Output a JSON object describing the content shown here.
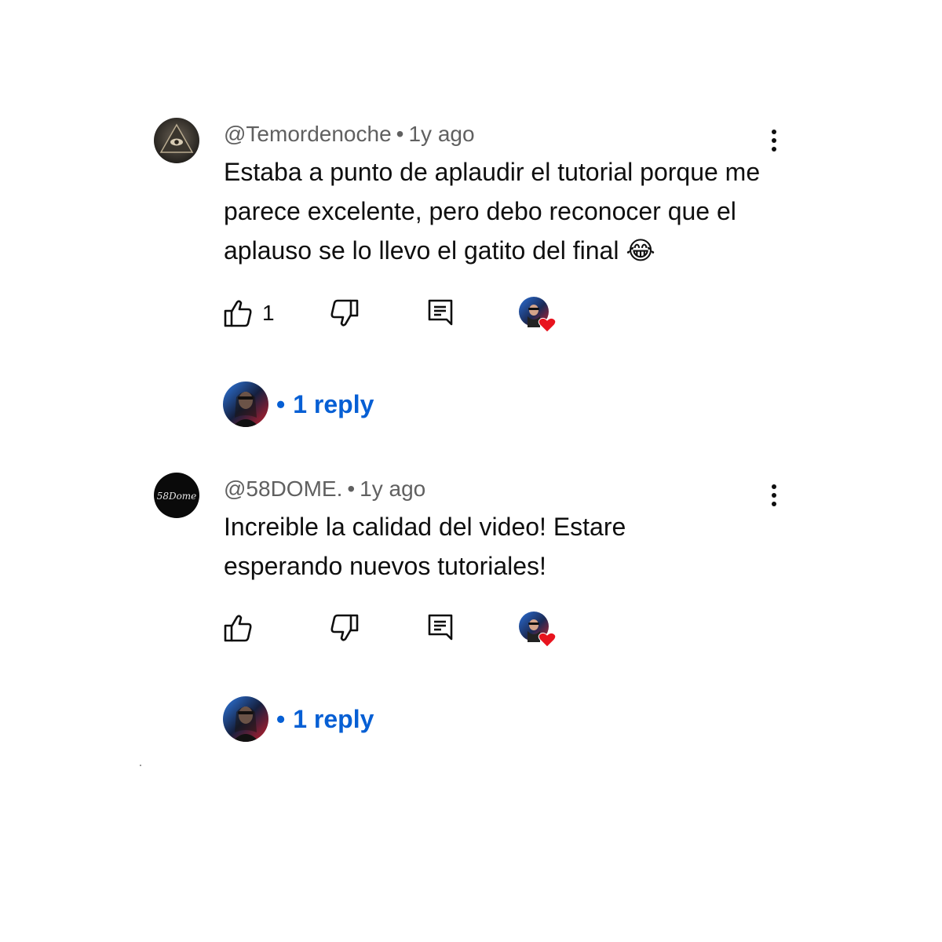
{
  "comments": [
    {
      "handle": "@Temordenoche",
      "separator": "•",
      "time": "1y ago",
      "text": "Estaba a punto de aplaudir el tutorial porque me parece excelente, pero debo reconocer que el aplauso se lo llevo el gatito del final",
      "emoji": "😂",
      "like_count": "1",
      "avatar_icon": "illuminati-eye-pyramid",
      "creator_hearted": true,
      "replies_separator": "•",
      "replies_label": "1 reply"
    },
    {
      "handle": "@58DOME.",
      "separator": "•",
      "time": "1y ago",
      "text": "Increible la calidad del video! Estare esperando nuevos tutoriales!",
      "emoji": "",
      "like_count": "",
      "avatar_icon": "58dome-logo",
      "avatar_logo_text": "58Dome",
      "creator_hearted": true,
      "replies_separator": "•",
      "replies_label": "1 reply"
    }
  ],
  "colors": {
    "text": "#0f0f0f",
    "meta": "#606060",
    "link": "#065fd4",
    "heart": "#e8131e"
  },
  "icons": [
    "thumbs-up-icon",
    "thumbs-down-icon",
    "reply-icon",
    "creator-heart-icon",
    "more-vert-icon"
  ]
}
